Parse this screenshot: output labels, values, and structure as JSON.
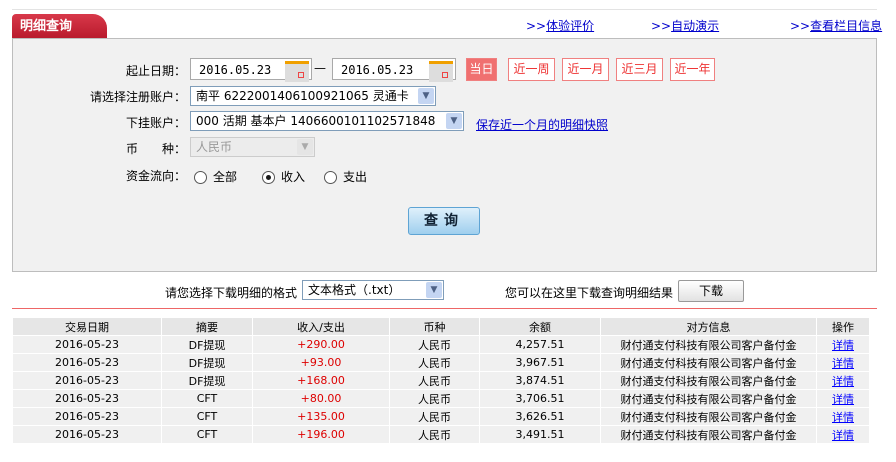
{
  "title": "明细查询",
  "top_links": [
    {
      "label": "体验评价"
    },
    {
      "label": "自动演示"
    },
    {
      "label": "查看栏目信息"
    }
  ],
  "link_prefix": ">>",
  "form": {
    "date_label": "起止日期：",
    "date_from": "2016.05.23",
    "date_sep": "—",
    "date_to": "2016.05.23",
    "quick_ranges": [
      {
        "label": "当日",
        "active": true
      },
      {
        "label": "近一周"
      },
      {
        "label": "近一月"
      },
      {
        "label": "近三月"
      },
      {
        "label": "近一年"
      }
    ],
    "account_label": "请选择注册账户：",
    "account_value": "南平 6222001406100921065 灵通卡",
    "sub_account_label": "下挂账户：",
    "sub_account_value": "000 活期 基本户 1406600101102571848",
    "save_snapshot_link": "保存近一个月的明细快照",
    "currency_label": "币　　种：",
    "currency_value": "人民币",
    "direction_label": "资金流向：",
    "direction_options": [
      "全部",
      "收入",
      "支出"
    ],
    "direction_selected": "收入",
    "query_button": "查询"
  },
  "download": {
    "format_label": "请您选择下载明细的格式",
    "format_value": "文本格式（.txt）",
    "hint": "您可以在这里下载查询明细结果",
    "button": "下载"
  },
  "table": {
    "headers": [
      "交易日期",
      "摘要",
      "收入/支出",
      "币种",
      "余额",
      "对方信息",
      "操作"
    ],
    "rows": [
      [
        "2016-05-23",
        "DF提现",
        "+290.00",
        "人民币",
        "4,257.51",
        "财付通支付科技有限公司客户备付金",
        "详情"
      ],
      [
        "2016-05-23",
        "DF提现",
        "+93.00",
        "人民币",
        "3,967.51",
        "财付通支付科技有限公司客户备付金",
        "详情"
      ],
      [
        "2016-05-23",
        "DF提现",
        "+168.00",
        "人民币",
        "3,874.51",
        "财付通支付科技有限公司客户备付金",
        "详情"
      ],
      [
        "2016-05-23",
        "CFT",
        "+80.00",
        "人民币",
        "3,706.51",
        "财付通支付科技有限公司客户备付金",
        "详情"
      ],
      [
        "2016-05-23",
        "CFT",
        "+135.00",
        "人民币",
        "3,626.51",
        "财付通支付科技有限公司客户备付金",
        "详情"
      ],
      [
        "2016-05-23",
        "CFT",
        "+196.00",
        "人民币",
        "3,491.51",
        "财付通支付科技有限公司客户备付金",
        "详情"
      ]
    ]
  },
  "colors": {
    "brand_red": "#c0202f",
    "amount": "#dd0000",
    "link": "#0000ee"
  }
}
